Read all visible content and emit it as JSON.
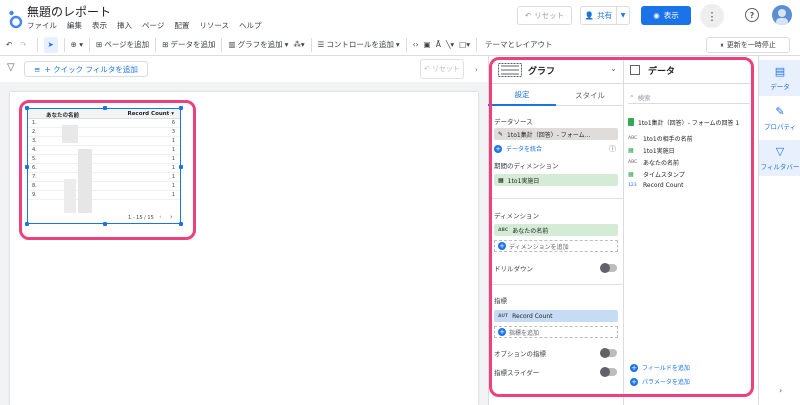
{
  "header": {
    "title": "無題のレポート",
    "menus": [
      "ファイル",
      "編集",
      "表示",
      "挿入",
      "ページ",
      "配置",
      "リソース",
      "ヘルプ"
    ],
    "reset_label": "リセット",
    "share_label": "共有",
    "view_label": "表示"
  },
  "toolbar": {
    "add_page": "ページを追加",
    "add_data": "データを追加",
    "add_chart": "グラフを追加",
    "add_control": "コントロールを追加",
    "theme_layout": "テーマとレイアウト",
    "pause_update": "更新を一時停止"
  },
  "filterbar": {
    "quick_filter": "+ クイック フィルタを追加",
    "reset_label": "リセット"
  },
  "table": {
    "col1": "あなたの名前",
    "col2": "Record Count",
    "rows": [
      {
        "n": "1.",
        "v": "6"
      },
      {
        "n": "2.",
        "v": "3"
      },
      {
        "n": "3.",
        "v": "1"
      },
      {
        "n": "4.",
        "v": "1"
      },
      {
        "n": "5.",
        "v": "1"
      },
      {
        "n": "6.",
        "v": "1"
      },
      {
        "n": "7.",
        "v": "1"
      },
      {
        "n": "8.",
        "v": "1"
      },
      {
        "n": "9.",
        "v": "1"
      }
    ],
    "pagination": "1 - 15 / 15"
  },
  "chart_panel": {
    "title": "グラフ",
    "tab_settings": "設定",
    "tab_style": "スタイル",
    "datasource_label": "データソース",
    "datasource_value": "1to1集計（回答）- フォーム...",
    "blend_data": "データを統合",
    "date_dimension_label": "期間のディメンション",
    "date_dimension_value": "1to1実施日",
    "dimension_label": "ディメンション",
    "dimension_value": "あなたの名前",
    "dimension_type": "ABC",
    "add_dimension": "ディメンションを追加",
    "drilldown_label": "ドリルダウン",
    "metric_label": "指標",
    "metric_value": "Record Count",
    "metric_type": "AUT",
    "add_metric": "指標を追加",
    "optional_metrics": "オプションの指標",
    "metric_slider": "指標スライダー"
  },
  "data_panel": {
    "title": "データ",
    "search_placeholder": "検索",
    "datasource": "1to1集計（回答）- フォームの回答 1",
    "fields": [
      {
        "type": "ABC",
        "name": "1to1の相手の名前"
      },
      {
        "type": "CAL",
        "name": "1to1実施日"
      },
      {
        "type": "ABC",
        "name": "あなたの名前"
      },
      {
        "type": "CAL",
        "name": "タイムスタンプ"
      },
      {
        "type": "123",
        "name": "Record Count"
      }
    ],
    "add_field": "フィールドを追加",
    "add_parameter": "パラメータを追加"
  },
  "rail": {
    "data": "データ",
    "properties": "プロパティ",
    "filter_bar": "フィルタバー"
  },
  "colors": {
    "accent": "#1a73e8",
    "highlight": "#ee3f7e"
  }
}
